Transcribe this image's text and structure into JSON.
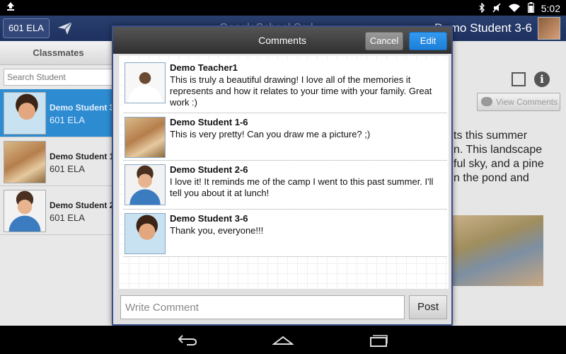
{
  "status_bar": {
    "time": "5:02"
  },
  "header": {
    "class_button": "601 ELA",
    "app_title": "GoogleSchool.Scrl",
    "student_name": "Demo Student 3-6"
  },
  "left_panel": {
    "tab_label": "Classmates",
    "search_placeholder": "Search Student",
    "students": [
      {
        "name": "Demo Student 3-6",
        "class": "601 ELA",
        "active": true
      },
      {
        "name": "Demo Student 1-6",
        "class": "601 ELA",
        "active": false
      },
      {
        "name": "Demo Student 2-6",
        "class": "601 ELA",
        "active": false
      }
    ]
  },
  "right_panel": {
    "view_comments_label": "View Comments",
    "description_lines": [
      "ts this summer",
      "n. This landscape",
      "ful sky, and a pine",
      "n the pond and"
    ]
  },
  "dialog": {
    "title": "Comments",
    "cancel_label": "Cancel",
    "edit_label": "Edit",
    "comments": [
      {
        "author": "Demo Teacher1",
        "text": "This is truly a beautiful drawing! I love all of the memories it represents and how it relates to your time with your family. Great work :)"
      },
      {
        "author": "Demo Student 1-6",
        "text": "This is very pretty! Can you draw me a picture? ;)"
      },
      {
        "author": "Demo Student 2-6",
        "text": "I love it! It reminds me of the camp I went to this past summer. I'll tell you about it at lunch!"
      },
      {
        "author": "Demo Student 3-6",
        "text": "Thank you, everyone!!!"
      }
    ],
    "input_placeholder": "Write Comment",
    "post_label": "Post"
  },
  "colors": {
    "header_bg": "#1e3160",
    "accent": "#2d8bd2",
    "dialog_border": "#3a4f8c",
    "edit_button": "#1d7fd8"
  }
}
